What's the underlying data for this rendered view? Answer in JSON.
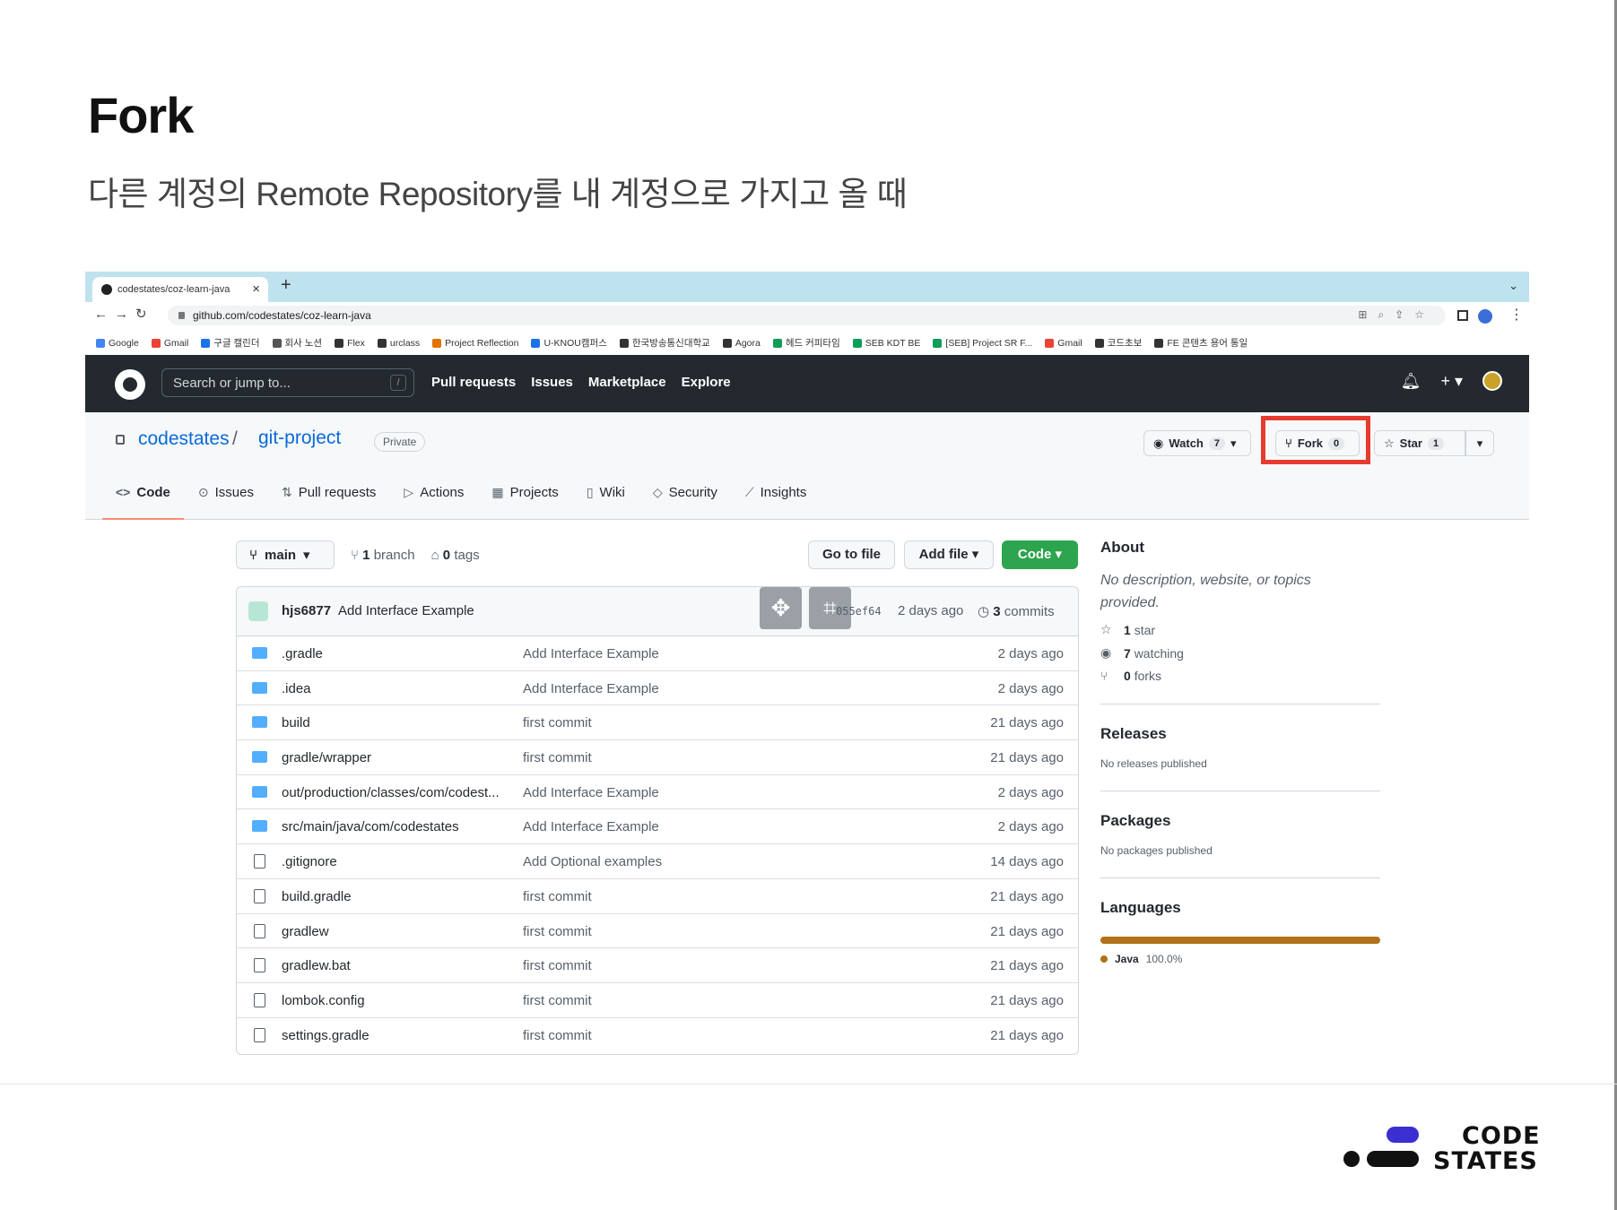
{
  "slide": {
    "title": "Fork",
    "subtitle": "다른 계정의 Remote Repository를 내 계정으로 가지고 올 때",
    "logo_line1": "CODE",
    "logo_line2": "STATES"
  },
  "browser": {
    "tab_title": "codestates/coz-learn-java",
    "tab_close": "×",
    "new_tab": "+",
    "url": "github.com/codestates/coz-learn-java",
    "bookmarks": [
      "Google",
      "Gmail",
      "구글 캘린더",
      "회사 노션",
      "Flex",
      "urclass",
      "Project Reflection",
      "U-KNOU캠퍼스",
      "한국방송통신대학교",
      "Agora",
      "헤드 커피타임",
      "SEB KDT BE",
      "[SEB] Project SR F...",
      "Gmail",
      "코드초보",
      "FE 콘텐츠 용어 통일"
    ]
  },
  "github": {
    "search_placeholder": "Search or jump to...",
    "search_shortcut": "/",
    "nav": [
      "Pull requests",
      "Issues",
      "Marketplace",
      "Explore"
    ],
    "owner": "codestates",
    "separator": "/",
    "repo": "git-project",
    "visibility": "Private",
    "watch_label": "Watch",
    "watch_count": "7",
    "fork_label": "Fork",
    "fork_count": "0",
    "star_label": "Star",
    "star_count": "1",
    "highlight_color": "#e63b2e",
    "tabs": [
      "Code",
      "Issues",
      "Pull requests",
      "Actions",
      "Projects",
      "Wiki",
      "Security",
      "Insights"
    ],
    "tab_icons": [
      "code-icon",
      "issue-icon",
      "pull-request-icon",
      "play-icon",
      "project-icon",
      "book-icon",
      "shield-icon",
      "graph-icon"
    ],
    "active_tab": "Code"
  },
  "main": {
    "branch": "main",
    "branch_count": "1",
    "branch_label": "branch",
    "tag_count": "0",
    "tag_label": "tags",
    "goto_file": "Go to file",
    "add_file": "Add file ▾",
    "code_btn": "Code ▾",
    "commit": {
      "user": "hjs6877",
      "message": "Add Interface Example",
      "sha": "055ef64",
      "when": "2 days ago",
      "count": "3",
      "count_label": "commits"
    },
    "files": [
      {
        "type": "dir",
        "name": ".gradle",
        "message": "Add Interface Example",
        "age": "2 days ago"
      },
      {
        "type": "dir",
        "name": ".idea",
        "message": "Add Interface Example",
        "age": "2 days ago"
      },
      {
        "type": "dir",
        "name": "build",
        "message": "first commit",
        "age": "21 days ago"
      },
      {
        "type": "dir",
        "name": "gradle/wrapper",
        "message": "first commit",
        "age": "21 days ago"
      },
      {
        "type": "dir",
        "name": "out/production/classes/com/codest...",
        "message": "Add Interface Example",
        "age": "2 days ago"
      },
      {
        "type": "dir",
        "name": "src/main/java/com/codestates",
        "message": "Add Interface Example",
        "age": "2 days ago"
      },
      {
        "type": "file",
        "name": ".gitignore",
        "message": "Add Optional examples",
        "age": "14 days ago"
      },
      {
        "type": "file",
        "name": "build.gradle",
        "message": "first commit",
        "age": "21 days ago"
      },
      {
        "type": "file",
        "name": "gradlew",
        "message": "first commit",
        "age": "21 days ago"
      },
      {
        "type": "file",
        "name": "gradlew.bat",
        "message": "first commit",
        "age": "21 days ago"
      },
      {
        "type": "file",
        "name": "lombok.config",
        "message": "first commit",
        "age": "21 days ago"
      },
      {
        "type": "file",
        "name": "settings.gradle",
        "message": "first commit",
        "age": "21 days ago"
      }
    ]
  },
  "sidebar": {
    "about_title": "About",
    "about_desc": "No description, website, or topics provided.",
    "stars": "1",
    "stars_label": "star",
    "watching": "7",
    "watching_label": "watching",
    "forks": "0",
    "forks_label": "forks",
    "releases_title": "Releases",
    "releases_text": "No releases published",
    "packages_title": "Packages",
    "packages_text": "No packages published",
    "languages_title": "Languages",
    "language": "Java",
    "language_pct": "100.0%",
    "language_color": "#b07219"
  }
}
